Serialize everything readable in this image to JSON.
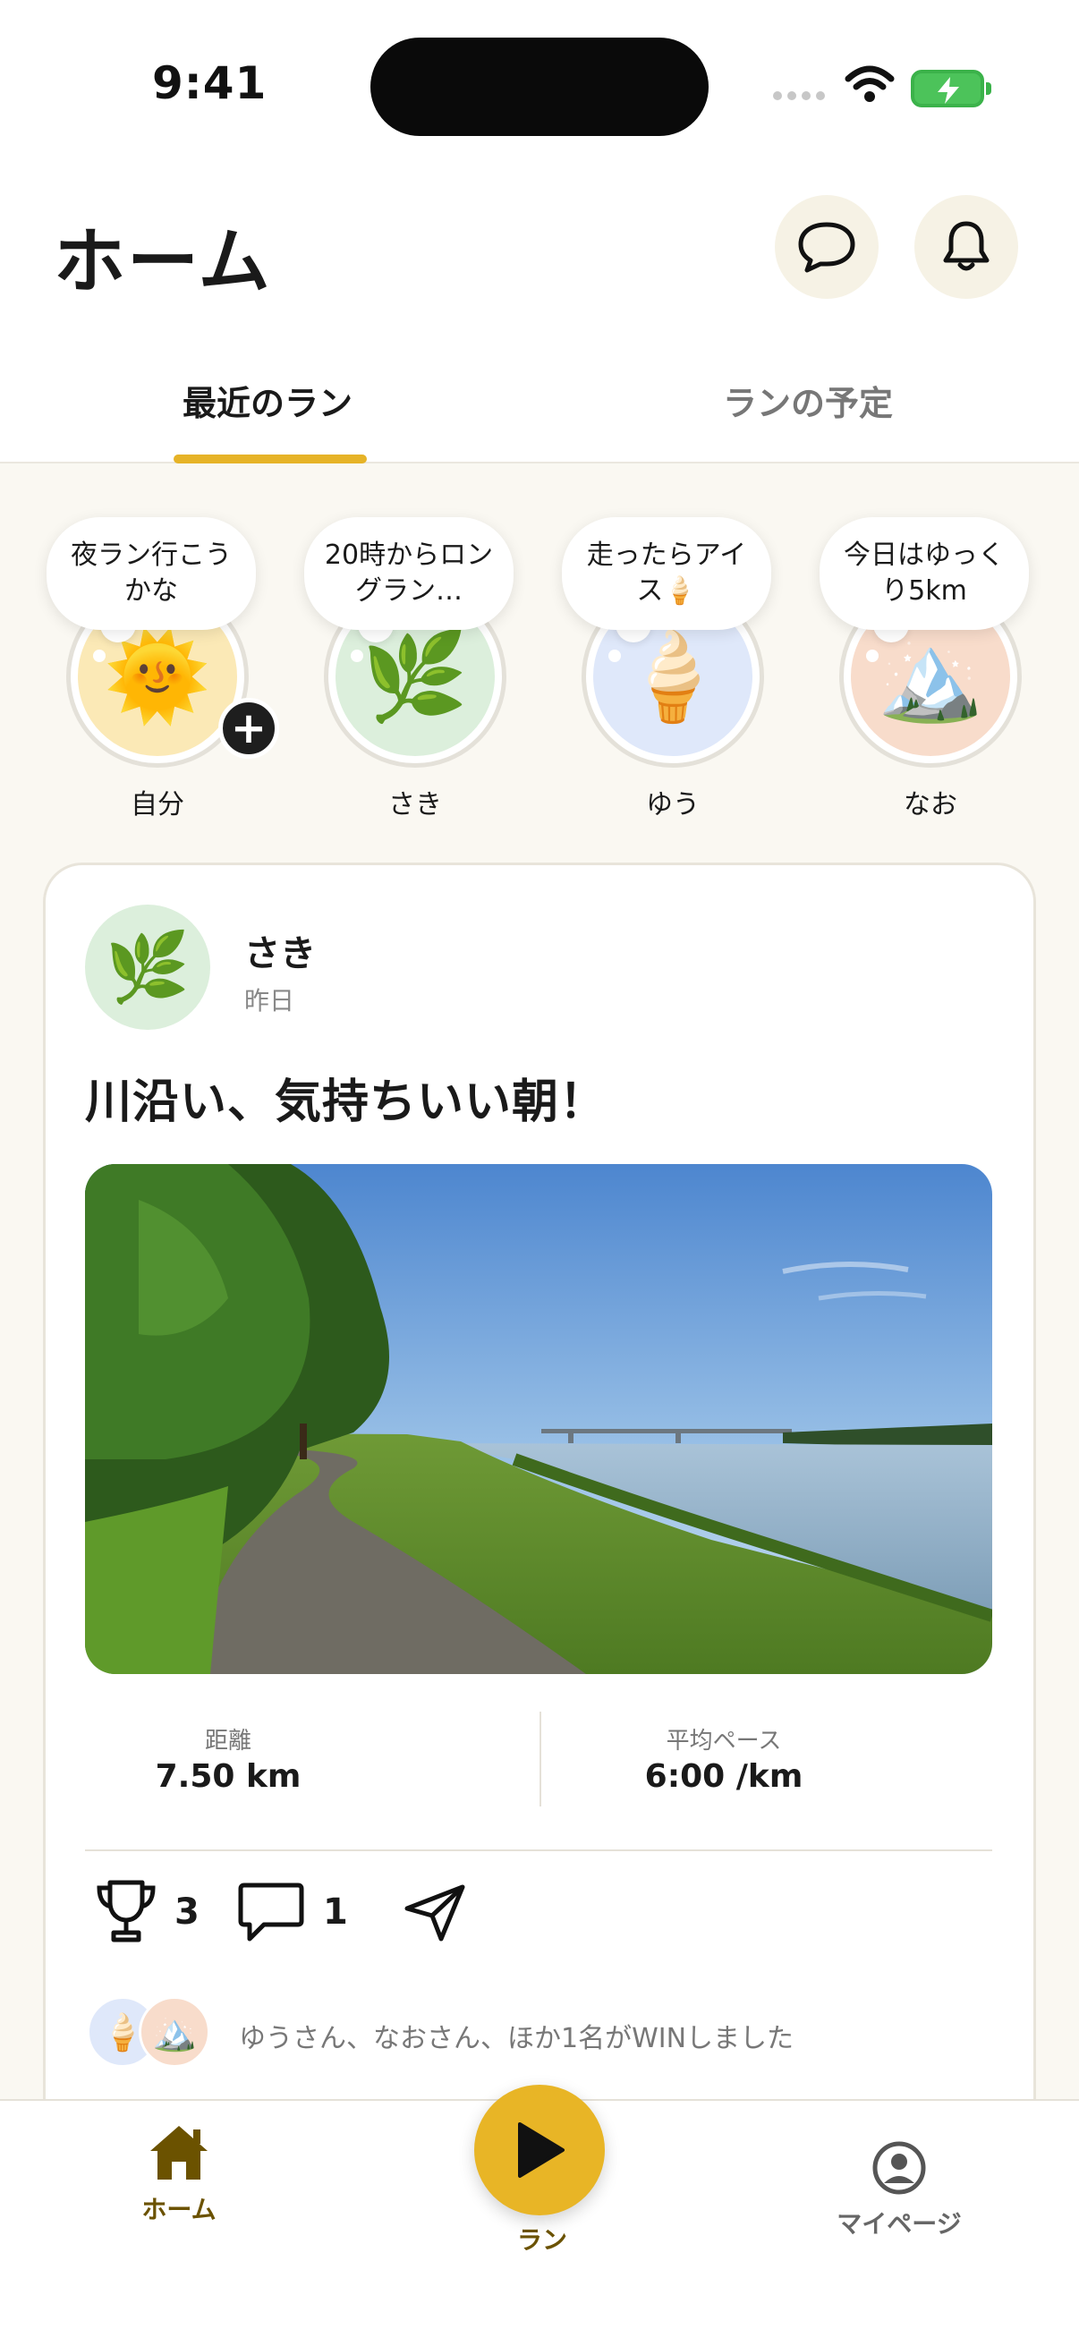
{
  "status_bar": {
    "time": "9:41"
  },
  "header": {
    "title": "ホーム"
  },
  "tabs": [
    {
      "label": "最近のラン",
      "active": true
    },
    {
      "label": "ランの予定",
      "active": false
    }
  ],
  "stories": [
    {
      "name": "自分",
      "bubble": "夜ラン行こうかな",
      "emoji": "🌞",
      "bg": "#fbe9b6",
      "add": true
    },
    {
      "name": "さき",
      "bubble": "20時からロングラン…",
      "emoji": "🌿",
      "bg": "#dcefdc"
    },
    {
      "name": "ゆう",
      "bubble": "走ったらアイス🍦",
      "emoji": "🍦",
      "bg": "#dfe8fa"
    },
    {
      "name": "なお",
      "bubble": "今日はゆっくり5km",
      "emoji": "🏔️",
      "bg": "#f8dccb"
    }
  ],
  "post": {
    "author": "さき",
    "time": "昨日",
    "avatar_emoji": "🌿",
    "title": "川沿い、気持ちいい朝！",
    "stats": [
      {
        "label": "距離",
        "value": "7.50 km"
      },
      {
        "label": "平均ペース",
        "value": "6:00 /km"
      }
    ],
    "actions": {
      "wins": "3",
      "comments": "1"
    },
    "win_avatars": [
      "🍦",
      "🏔️"
    ],
    "win_text": "ゆうさん、なおさん、ほか1名がWINしました"
  },
  "bottom_nav": {
    "home": "ホーム",
    "run": "ラン",
    "mypage": "マイページ"
  },
  "colors": {
    "accent": "#e8b526",
    "home_active": "#6b5200",
    "background": "#faf8f2"
  }
}
